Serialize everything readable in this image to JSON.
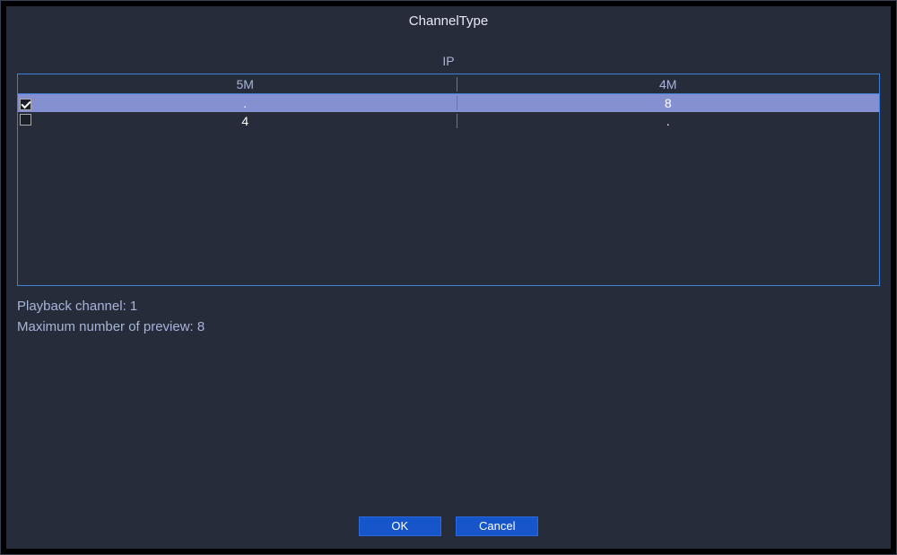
{
  "title": "ChannelType",
  "ip_label": "IP",
  "columns": {
    "col1": "5M",
    "col2": "4M"
  },
  "rows": [
    {
      "checked": true,
      "val1": ".",
      "val2": "8"
    },
    {
      "checked": false,
      "val1": "4",
      "val2": "."
    }
  ],
  "playback_label": "Playback channel: 1",
  "maxpreview_label": "Maximum number of preview: 8",
  "buttons": {
    "ok": "OK",
    "cancel": "Cancel"
  }
}
